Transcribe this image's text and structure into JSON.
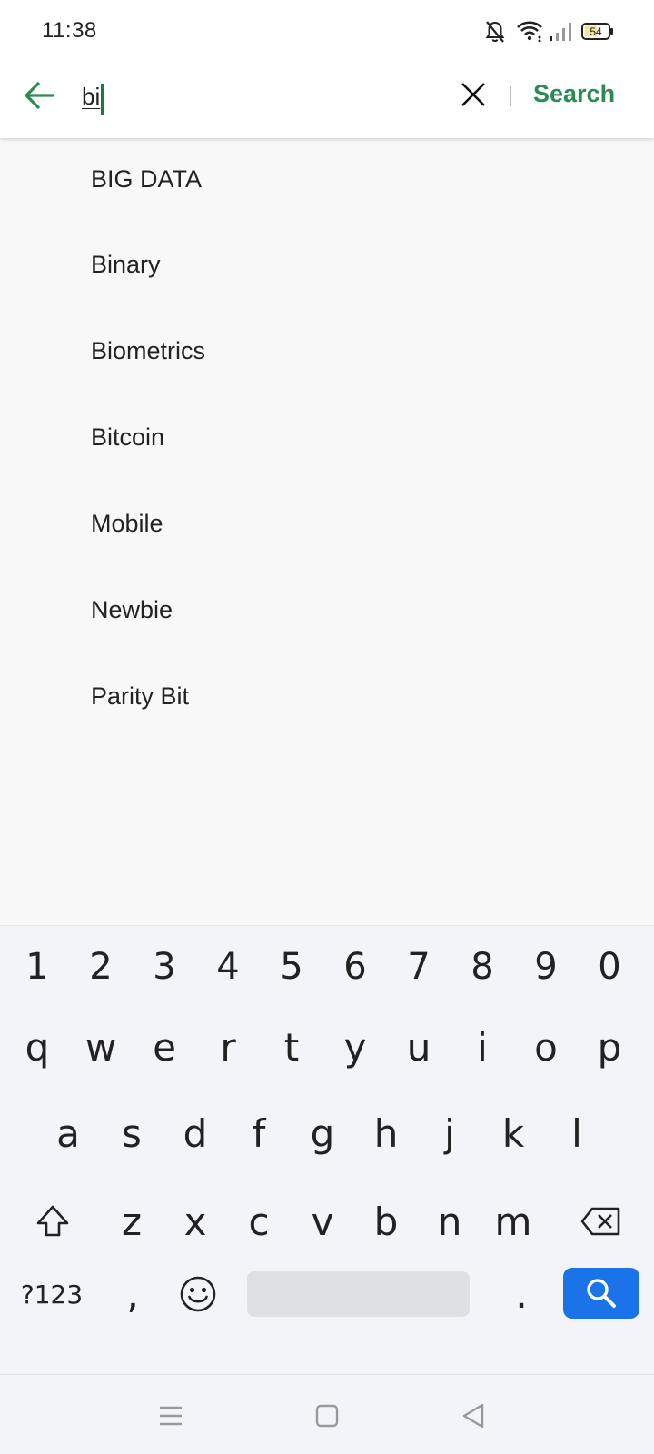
{
  "status_bar": {
    "time": "11:38",
    "battery": "54"
  },
  "search": {
    "query": "bi",
    "action_label": "Search",
    "accent_color": "#2e8a55"
  },
  "suggestions": [
    "BIG DATA",
    "Binary",
    "Biometrics",
    "Bitcoin",
    "Mobile",
    "Newbie",
    "Parity Bit"
  ],
  "keyboard": {
    "numbers": [
      "1",
      "2",
      "3",
      "4",
      "5",
      "6",
      "7",
      "8",
      "9",
      "0"
    ],
    "row1": [
      "q",
      "w",
      "e",
      "r",
      "t",
      "y",
      "u",
      "i",
      "o",
      "p"
    ],
    "row2": [
      "a",
      "s",
      "d",
      "f",
      "g",
      "h",
      "j",
      "k",
      "l"
    ],
    "row3": [
      "z",
      "x",
      "c",
      "v",
      "b",
      "n",
      "m"
    ],
    "symbols_label": "?123",
    "comma": ",",
    "period": ".",
    "enter_color": "#1a73e8"
  }
}
